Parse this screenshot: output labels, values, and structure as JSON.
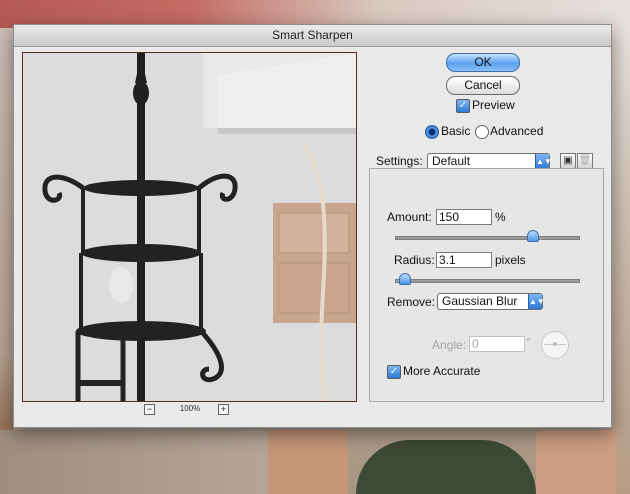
{
  "window": {
    "title": "Smart Sharpen"
  },
  "buttons": {
    "ok": "OK",
    "cancel": "Cancel"
  },
  "preview": {
    "checkbox_label": "Preview",
    "checked": true
  },
  "mode": {
    "basic": "Basic",
    "advanced": "Advanced",
    "selected": "Basic"
  },
  "settings": {
    "label": "Settings:",
    "value": "Default",
    "amount_label": "Amount:",
    "amount_value": "150",
    "amount_unit": "%",
    "amount_fraction": 0.75,
    "radius_label": "Radius:",
    "radius_value": "3.1",
    "radius_unit": "pixels",
    "radius_fraction": 0.05,
    "remove_label": "Remove:",
    "remove_value": "Gaussian Blur",
    "angle_label": "Angle:",
    "angle_value": "0",
    "angle_unit": "°",
    "more_accurate_label": "More Accurate",
    "more_accurate_checked": true
  },
  "zoom": {
    "value": "100%",
    "minus": "−",
    "plus": "+"
  },
  "icons": {
    "save_settings": "disk-icon",
    "delete_settings": "trash-icon"
  }
}
